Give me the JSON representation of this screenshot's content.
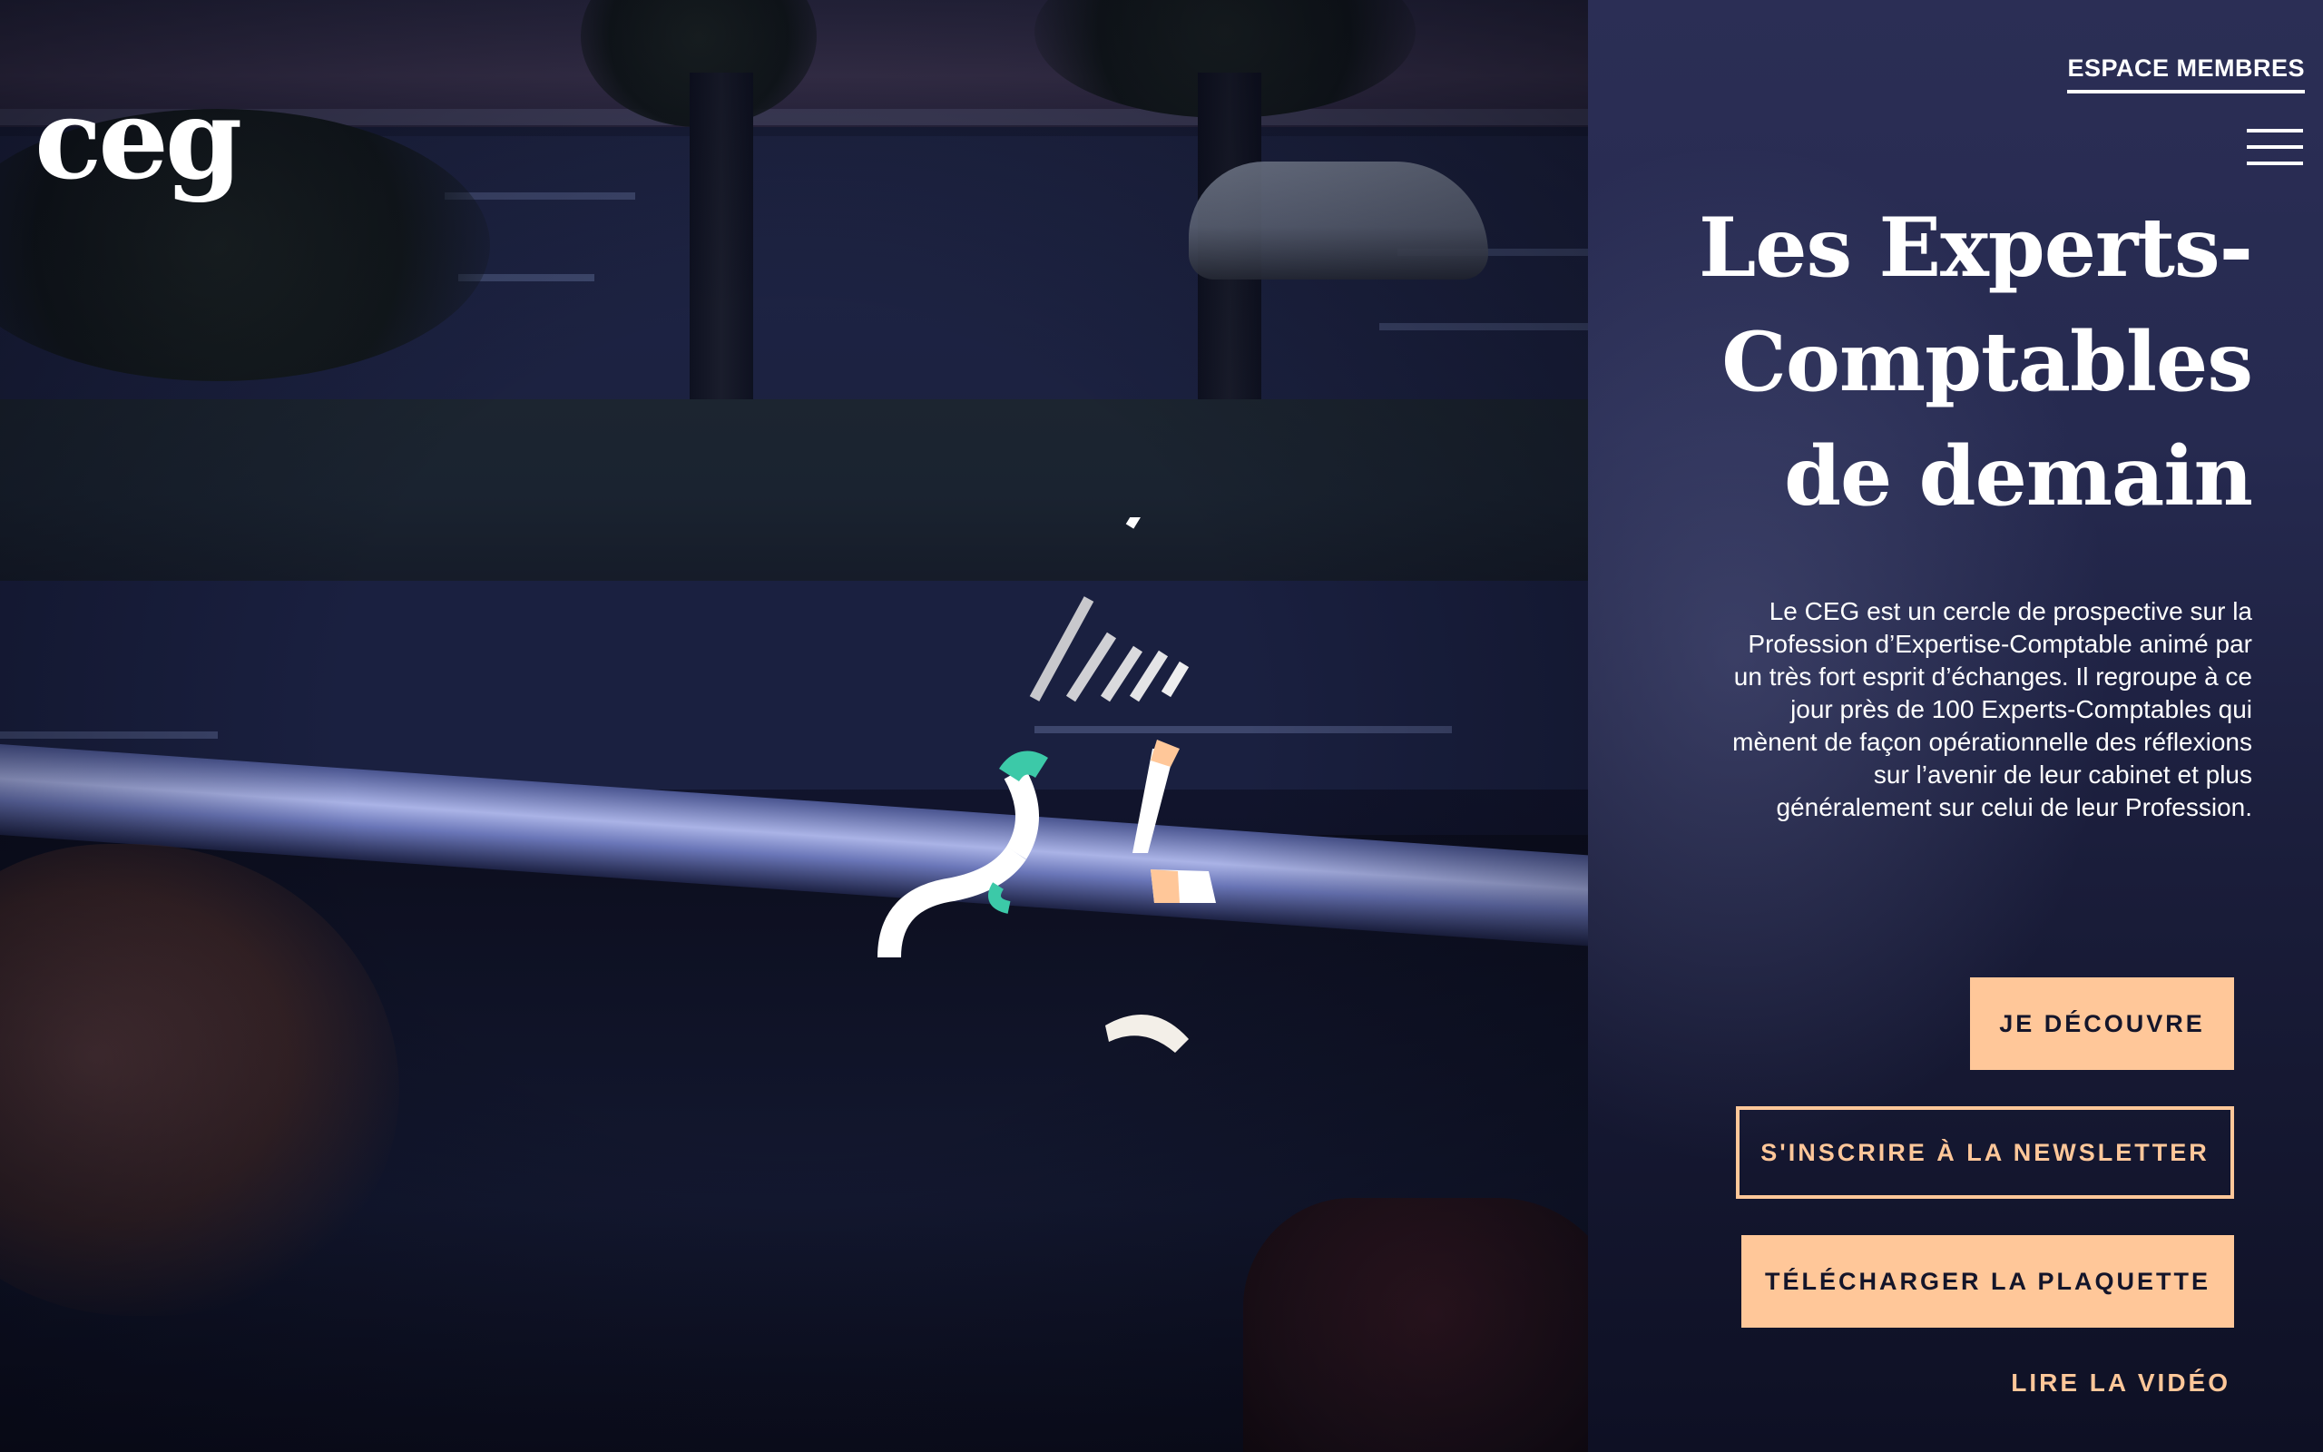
{
  "brand": {
    "logo_text": "ceg"
  },
  "header": {
    "member_link": "ESPACE MEMBRES",
    "menu_icon": "hamburger-menu-icon"
  },
  "hero": {
    "title_line1": "Les Experts-",
    "title_line2": "Comptables",
    "title_line3": "de demain",
    "intro_line1": "Le CEG est un cercle de prospective sur la",
    "intro_line2": "Profession d’Expertise-Comptable animé par",
    "intro_line3": "un très fort esprit d’échanges. Il regroupe à ce",
    "intro_line4": "jour près de 100 Experts-Comptables qui",
    "intro_line5": "mènent de façon opérationnelle des réflexions",
    "intro_line6": "sur l’avenir de leur cabinet et plus",
    "intro_line7": "généralement sur celui de leur Profession."
  },
  "actions": {
    "discover_label": "JE DÉCOUVRE",
    "newsletter_label": "S'INSCRIRE À LA NEWSLETTER",
    "brochure_label": "TÉLÉCHARGER LA PLAQUETTE",
    "video_label": "LIRE LA VIDÉO"
  },
  "colors": {
    "accent": "#ffc799",
    "loader_teal": "#3cc9a8",
    "panel_bg": "#262a50",
    "text": "#ffffff"
  },
  "icons": {
    "loader": "animated-loader-icon"
  }
}
